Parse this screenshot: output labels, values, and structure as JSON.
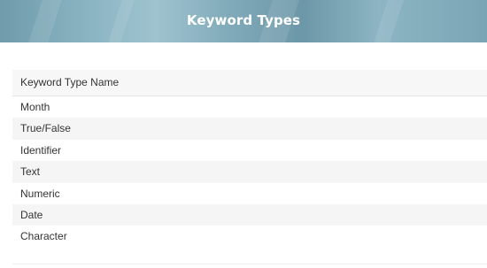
{
  "page": {
    "title": "Keyword Types"
  },
  "table": {
    "header": "Keyword Type Name",
    "rows": [
      "Month",
      "True/False",
      "Identifier",
      "Text",
      "Numeric",
      "Date",
      "Character"
    ]
  },
  "colors": {
    "banner": "#7fa9b8",
    "banner_text": "#ffffff",
    "stripe": "#f5f5f5",
    "text": "#333333"
  }
}
